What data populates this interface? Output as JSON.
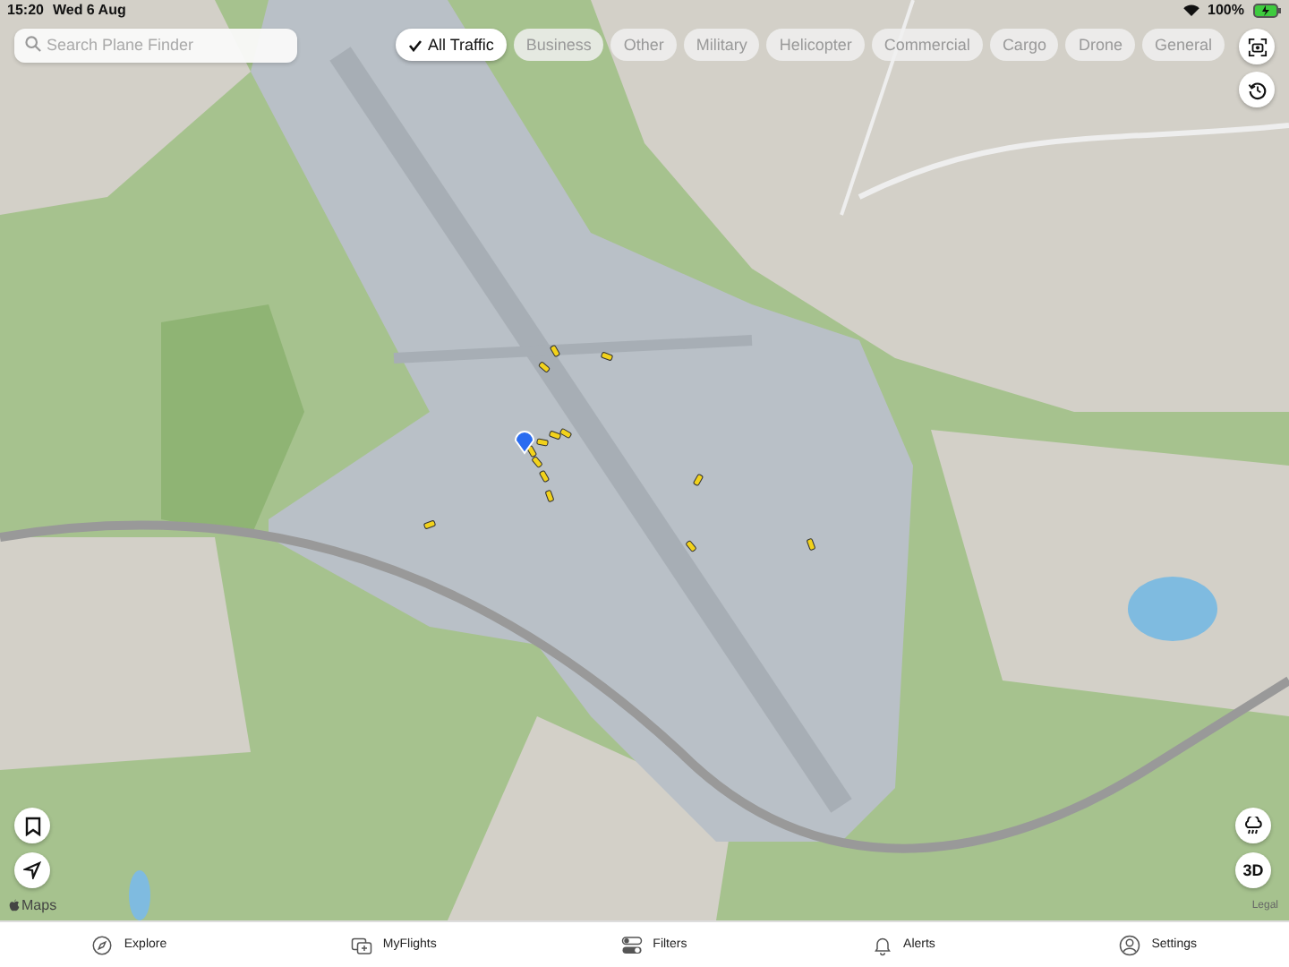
{
  "status_bar": {
    "time": "15:20",
    "date": "Wed 6 Aug",
    "battery": "100%"
  },
  "search": {
    "placeholder": "Search Plane Finder"
  },
  "filters": [
    {
      "label": "All Traffic",
      "selected": true
    },
    {
      "label": "Business",
      "selected": false
    },
    {
      "label": "Other",
      "selected": false
    },
    {
      "label": "Military",
      "selected": false
    },
    {
      "label": "Helicopter",
      "selected": false
    },
    {
      "label": "Commercial",
      "selected": false
    },
    {
      "label": "Cargo",
      "selected": false
    },
    {
      "label": "Drone",
      "selected": false
    },
    {
      "label": "General",
      "selected": false
    }
  ],
  "map": {
    "attribution": "Maps",
    "legal": "Legal",
    "view_button": "3D"
  },
  "tab_bar": [
    {
      "label": "Explore",
      "kind": "compass"
    },
    {
      "label": "MyFlights",
      "kind": "flights"
    },
    {
      "label": "Filters",
      "kind": "toggles"
    },
    {
      "label": "Alerts",
      "kind": "bell"
    },
    {
      "label": "Settings",
      "kind": "person"
    }
  ]
}
